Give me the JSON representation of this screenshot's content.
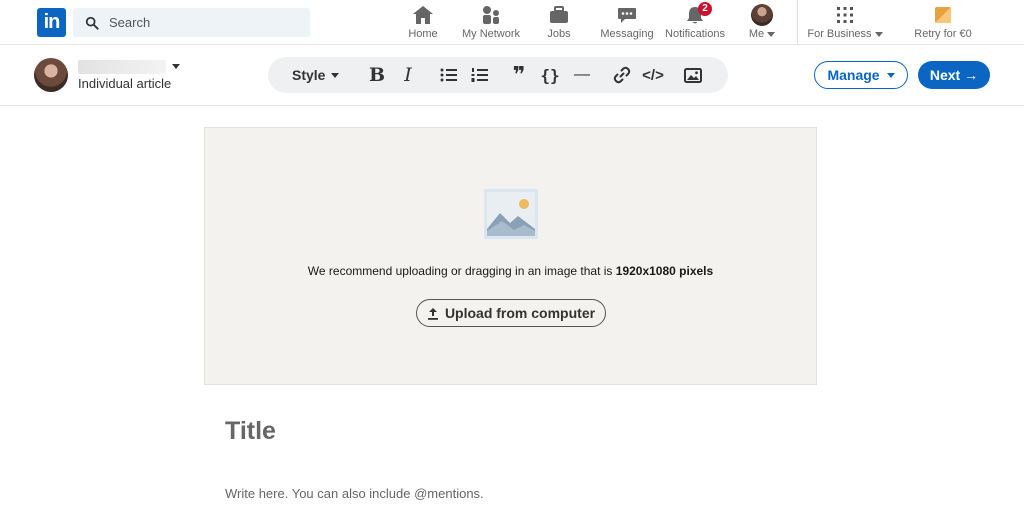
{
  "app": {
    "logo_text": "in"
  },
  "nav": {
    "search_placeholder": "Search",
    "items": [
      {
        "label": "Home"
      },
      {
        "label": "My Network"
      },
      {
        "label": "Jobs"
      },
      {
        "label": "Messaging"
      },
      {
        "label": "Notifications",
        "badge": "2"
      },
      {
        "label": "Me"
      },
      {
        "label": "For Business"
      },
      {
        "label": "Retry for €0"
      }
    ]
  },
  "editor": {
    "article_type": "Individual article",
    "toolbar": {
      "style_label": "Style",
      "bold_glyph": "B",
      "italic_glyph": "I",
      "quote_glyph": "❞",
      "code_block_glyph": "{}",
      "divider_glyph": "—",
      "embed_glyph": "</>"
    },
    "manage_label": "Manage",
    "next_label": "Next →"
  },
  "cover": {
    "recommend_text": "We recommend uploading or dragging in an image that is ",
    "recommend_size": "1920x1080 pixels",
    "upload_label": "Upload from computer"
  },
  "article": {
    "title_placeholder": "Title",
    "body_placeholder": "Write here. You can also include @mentions."
  },
  "colors": {
    "brand": "#0a66c2",
    "badge": "#cb112d",
    "cover_bg": "#f3f2ef"
  }
}
